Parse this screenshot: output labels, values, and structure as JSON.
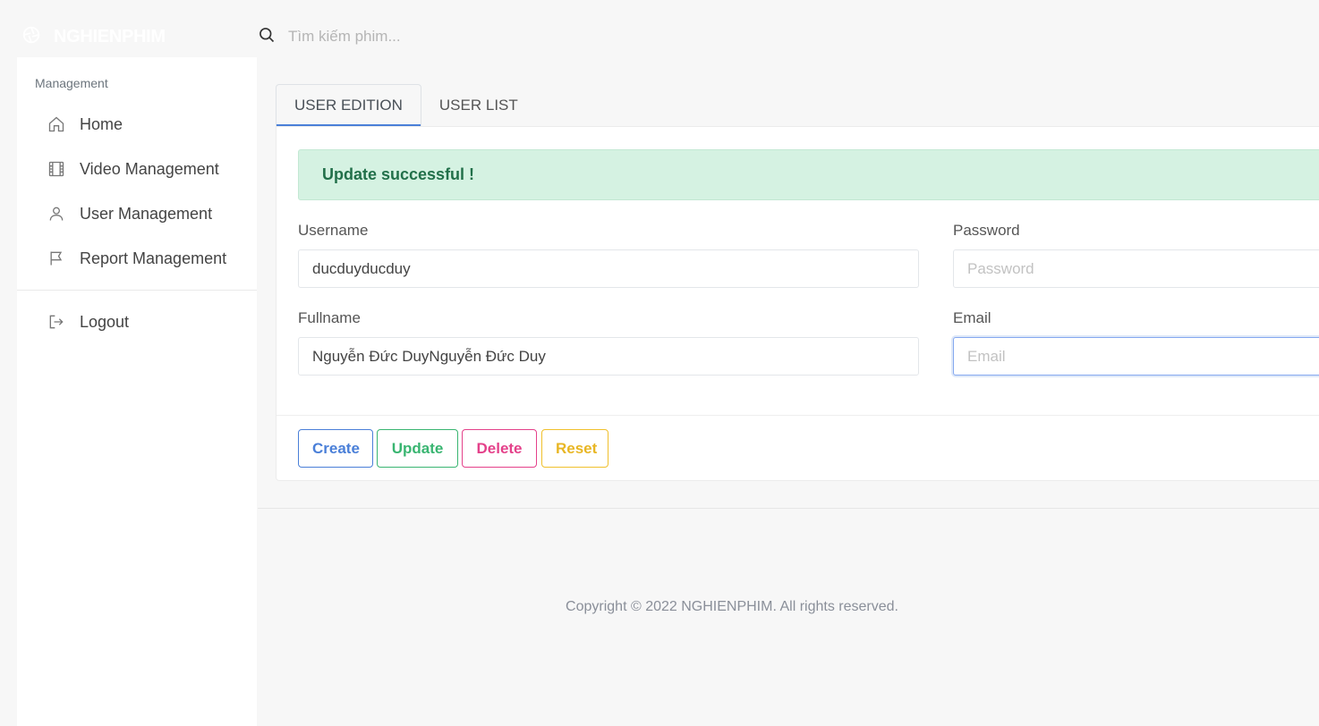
{
  "brand": {
    "name": "NGHIENPHIM",
    "logo_icon": "aperture-icon"
  },
  "search": {
    "placeholder": "Tìm kiếm phim...",
    "icon": "search-icon"
  },
  "sidebar": {
    "heading": "Management",
    "items": [
      {
        "label": "Home",
        "icon": "home-icon"
      },
      {
        "label": "Video Management",
        "icon": "film-icon"
      },
      {
        "label": "User Management",
        "icon": "user-icon"
      },
      {
        "label": "Report Management",
        "icon": "flag-icon"
      }
    ],
    "logout": {
      "label": "Logout",
      "icon": "logout-icon"
    }
  },
  "tabs": [
    {
      "label": "USER EDITION",
      "active": true
    },
    {
      "label": "USER LIST",
      "active": false
    }
  ],
  "alert": {
    "message": "Update successful !"
  },
  "form": {
    "username": {
      "label": "Username",
      "value": "ducduyducduy"
    },
    "password": {
      "label": "Password",
      "placeholder": "Password",
      "value": ""
    },
    "fullname": {
      "label": "Fullname",
      "value": "Nguyễn Đức DuyNguyễn Đức Duy"
    },
    "email": {
      "label": "Email",
      "placeholder": "Email",
      "value": ""
    }
  },
  "buttons": {
    "create": "Create",
    "update": "Update",
    "delete": "Delete",
    "reset": "Reset"
  },
  "footer": {
    "text": "Copyright © 2022 NGHIENPHIM. All rights reserved."
  },
  "colors": {
    "primary": "#4a7fd8",
    "success": "#39b571",
    "danger": "#e4418a",
    "warning": "#f0c02c",
    "alert_bg": "#d5f2e2",
    "alert_text": "#22704a"
  }
}
